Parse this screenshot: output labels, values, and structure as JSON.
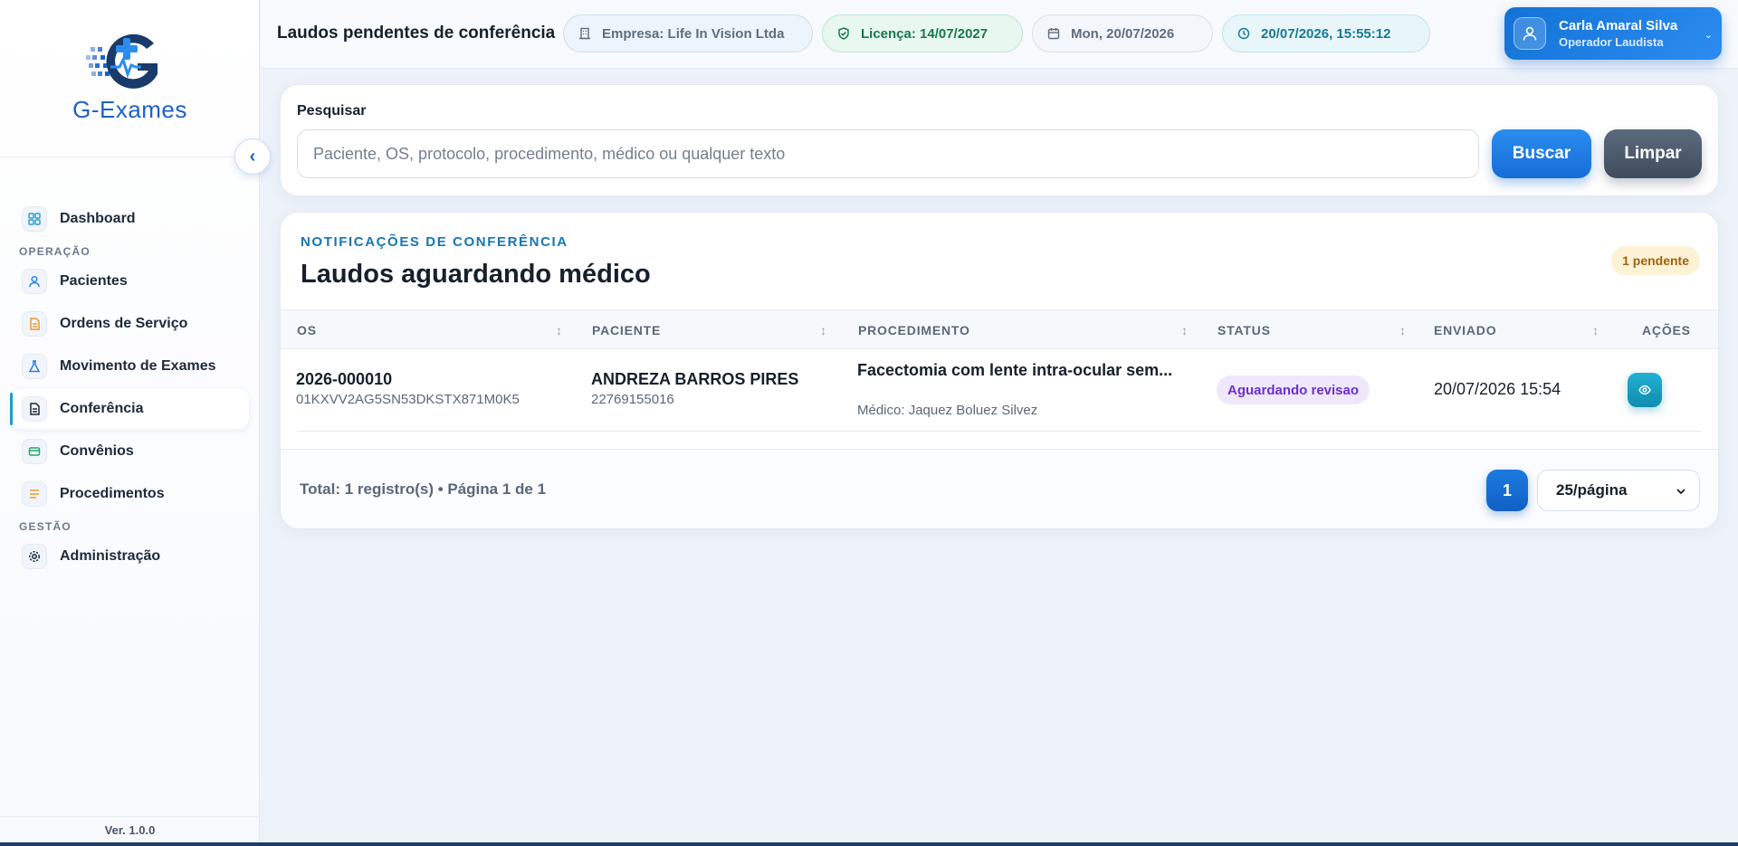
{
  "brand": {
    "name": "G-Exames"
  },
  "sidebar": {
    "items": [
      {
        "label": "Dashboard"
      },
      {
        "section": "OPERAÇÃO"
      },
      {
        "label": "Pacientes"
      },
      {
        "label": "Ordens de Serviço"
      },
      {
        "label": "Movimento de Exames"
      },
      {
        "label": "Conferência"
      },
      {
        "label": "Convênios"
      },
      {
        "label": "Procedimentos"
      },
      {
        "section": "GESTÃO"
      },
      {
        "label": "Administração"
      }
    ],
    "version": "Ver. 1.0.0"
  },
  "header": {
    "title": "Laudos pendentes de conferência",
    "empresa": "Empresa: Life In Vision Ltda",
    "licenca": "Licença: 14/07/2027",
    "date": "Mon, 20/07/2026",
    "datetime": "20/07/2026, 15:55:12",
    "user": {
      "name": "Carla Amaral Silva",
      "role": "Operador Laudista"
    }
  },
  "search": {
    "label": "Pesquisar",
    "placeholder": "Paciente, OS, protocolo, procedimento, médico ou qualquer texto",
    "value": "",
    "buscar": "Buscar",
    "limpar": "Limpar"
  },
  "main": {
    "eyebrow": "NOTIFICAÇÕES DE CONFERÊNCIA",
    "title": "Laudos aguardando médico",
    "pending_badge": "1 pendente",
    "columns": [
      "OS",
      "PACIENTE",
      "PROCEDIMENTO",
      "STATUS",
      "ENVIADO",
      "AÇÕES"
    ],
    "rows": [
      {
        "os": "2026-000010",
        "os_id": "01KXVV2AG5SN53DKSTX871M0K5",
        "paciente": "ANDREZA BARROS PIRES",
        "paciente_doc": "22769155016",
        "procedimento": "Facectomia com lente intra-ocular sem...",
        "medico": "Médico: Jaquez Boluez Silvez",
        "status": "Aguardando revisao",
        "enviado": "20/07/2026 15:54"
      }
    ],
    "footer": {
      "summary": "Total: 1 registro(s) • Página 1 de 1",
      "page": "1",
      "page_size": "25/página"
    }
  },
  "colors": {
    "brand": "#1b62c8",
    "accent": "#1272d6",
    "status_purple": "#6a2fd0",
    "pending_amber": "#a0620c"
  },
  "icons": {
    "nav": [
      "grid-icon",
      "user-icon",
      "document-icon",
      "flask-icon",
      "clipboard-icon",
      "card-icon",
      "list-icon",
      "gear-icon"
    ],
    "header": [
      "building-icon",
      "shield-check-icon",
      "calendar-icon",
      "clock-icon",
      "user-icon",
      "chevron-down-icon"
    ],
    "actions": [
      "eye-icon"
    ]
  }
}
